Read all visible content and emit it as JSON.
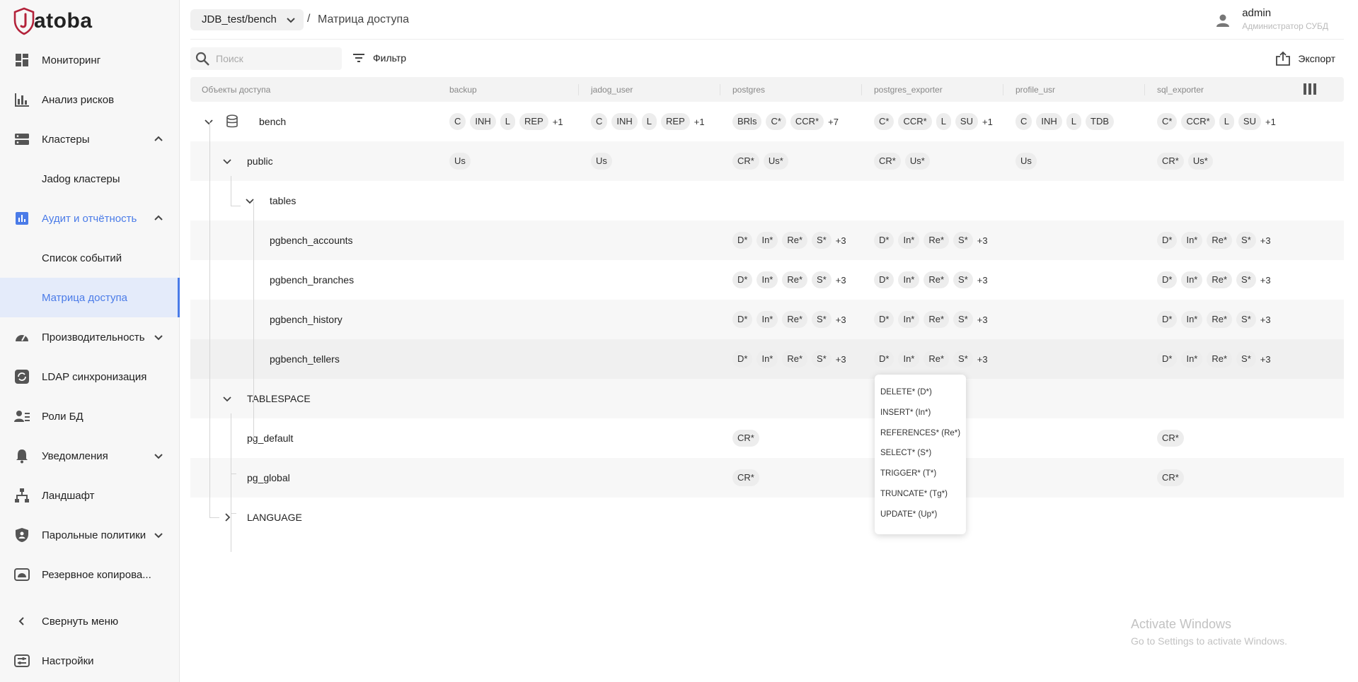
{
  "brand": {
    "name": "atoba",
    "accent": "#4a7be8",
    "logo_color": "#b3223a"
  },
  "sidebar": {
    "items": [
      {
        "label": "Мониторинг",
        "icon": "dashboard-icon"
      },
      {
        "label": "Анализ рисков",
        "icon": "bar-chart-icon"
      },
      {
        "label": "Кластеры",
        "icon": "server-icon",
        "expanded": true
      },
      {
        "label": "Jadog кластеры"
      },
      {
        "label": "Аудит и отчётность",
        "icon": "report-icon",
        "expanded": true
      },
      {
        "label": "Список событий"
      },
      {
        "label": "Матрица доступа",
        "active": true
      },
      {
        "label": "Производительность",
        "icon": "speed-icon"
      },
      {
        "label": "LDAP синхронизация",
        "icon": "sync-icon"
      },
      {
        "label": "Роли БД",
        "icon": "roles-icon"
      },
      {
        "label": "Уведомления",
        "icon": "bell-icon"
      },
      {
        "label": "Ландшафт",
        "icon": "sitemap-icon"
      },
      {
        "label": "Парольные политики",
        "icon": "shield-icon"
      },
      {
        "label": "Резервное копирова...",
        "icon": "backup-icon"
      },
      {
        "label": "Свернуть меню",
        "icon": "chevron-left-icon"
      },
      {
        "label": "Настройки",
        "icon": "settings-icon"
      }
    ]
  },
  "header": {
    "db": "JDB_test/bench",
    "separator": "/",
    "crumb": "Матрица доступа",
    "user": {
      "name": "admin",
      "role": "Администратор СУБД"
    }
  },
  "toolbar": {
    "search_placeholder": "Поиск",
    "filter_label": "Фильтр",
    "export_label": "Экспорт"
  },
  "table": {
    "columns": [
      "Объекты доступа",
      "backup",
      "jadog_user",
      "postgres",
      "postgres_exporter",
      "profile_usr",
      "sql_exporter"
    ],
    "rows": [
      {
        "name": "bench",
        "cells": [
          {
            "chips": [
              "C",
              "INH",
              "L",
              "REP"
            ],
            "more": "+1"
          },
          {
            "chips": [
              "C",
              "INH",
              "L",
              "REP"
            ],
            "more": "+1"
          },
          {
            "chips": [
              "BRls",
              "C*",
              "CCR*"
            ],
            "more": "+7"
          },
          {
            "chips": [
              "C*",
              "CCR*",
              "L",
              "SU"
            ],
            "more": "+1"
          },
          {
            "chips": [
              "C",
              "INH",
              "L",
              "TDB"
            ],
            "more": ""
          },
          {
            "chips": [
              "C*",
              "CCR*",
              "L",
              "SU"
            ],
            "more": "+1"
          }
        ]
      },
      {
        "name": "public",
        "cells": [
          {
            "chips": [
              "Us"
            ],
            "more": ""
          },
          {
            "chips": [
              "Us"
            ],
            "more": ""
          },
          {
            "chips": [
              "CR*",
              "Us*"
            ],
            "more": ""
          },
          {
            "chips": [
              "CR*",
              "Us*"
            ],
            "more": ""
          },
          {
            "chips": [
              "Us"
            ],
            "more": ""
          },
          {
            "chips": [
              "CR*",
              "Us*"
            ],
            "more": ""
          }
        ]
      },
      {
        "name": "tables",
        "cells": []
      },
      {
        "name": "pgbench_accounts",
        "cells": [
          null,
          null,
          {
            "chips": [
              "D*",
              "In*",
              "Re*",
              "S*"
            ],
            "more": "+3"
          },
          {
            "chips": [
              "D*",
              "In*",
              "Re*",
              "S*"
            ],
            "more": "+3"
          },
          null,
          {
            "chips": [
              "D*",
              "In*",
              "Re*",
              "S*"
            ],
            "more": "+3"
          }
        ]
      },
      {
        "name": "pgbench_branches",
        "cells": [
          null,
          null,
          {
            "chips": [
              "D*",
              "In*",
              "Re*",
              "S*"
            ],
            "more": "+3"
          },
          {
            "chips": [
              "D*",
              "In*",
              "Re*",
              "S*"
            ],
            "more": "+3"
          },
          null,
          {
            "chips": [
              "D*",
              "In*",
              "Re*",
              "S*"
            ],
            "more": "+3"
          }
        ]
      },
      {
        "name": "pgbench_history",
        "cells": [
          null,
          null,
          {
            "chips": [
              "D*",
              "In*",
              "Re*",
              "S*"
            ],
            "more": "+3"
          },
          {
            "chips": [
              "D*",
              "In*",
              "Re*",
              "S*"
            ],
            "more": "+3"
          },
          null,
          {
            "chips": [
              "D*",
              "In*",
              "Re*",
              "S*"
            ],
            "more": "+3"
          }
        ]
      },
      {
        "name": "pgbench_tellers",
        "cells": [
          null,
          null,
          {
            "chips": [
              "D*",
              "In*",
              "Re*",
              "S*"
            ],
            "more": "+3"
          },
          {
            "chips": [
              "D*",
              "In*",
              "Re*",
              "S*"
            ],
            "more": "+3"
          },
          null,
          {
            "chips": [
              "D*",
              "In*",
              "Re*",
              "S*"
            ],
            "more": "+3"
          }
        ]
      },
      {
        "name": "TABLESPACE",
        "cells": []
      },
      {
        "name": "pg_default",
        "cells": [
          null,
          null,
          {
            "chips": [
              "CR*"
            ],
            "more": ""
          },
          null,
          null,
          {
            "chips": [
              "CR*"
            ],
            "more": ""
          }
        ]
      },
      {
        "name": "pg_global",
        "cells": [
          null,
          null,
          {
            "chips": [
              "CR*"
            ],
            "more": ""
          },
          null,
          null,
          {
            "chips": [
              "CR*"
            ],
            "more": ""
          }
        ]
      },
      {
        "name": "LANGUAGE",
        "cells": []
      }
    ]
  },
  "popover": {
    "items": [
      "DELETE* (D*)",
      "INSERT* (In*)",
      "REFERENCES* (Re*)",
      "SELECT* (S*)",
      "TRIGGER* (T*)",
      "TRUNCATE* (Tg*)",
      "UPDATE* (Up*)"
    ]
  },
  "watermark": {
    "line1": "Activate Windows",
    "line2": "Go to Settings to activate Windows."
  }
}
